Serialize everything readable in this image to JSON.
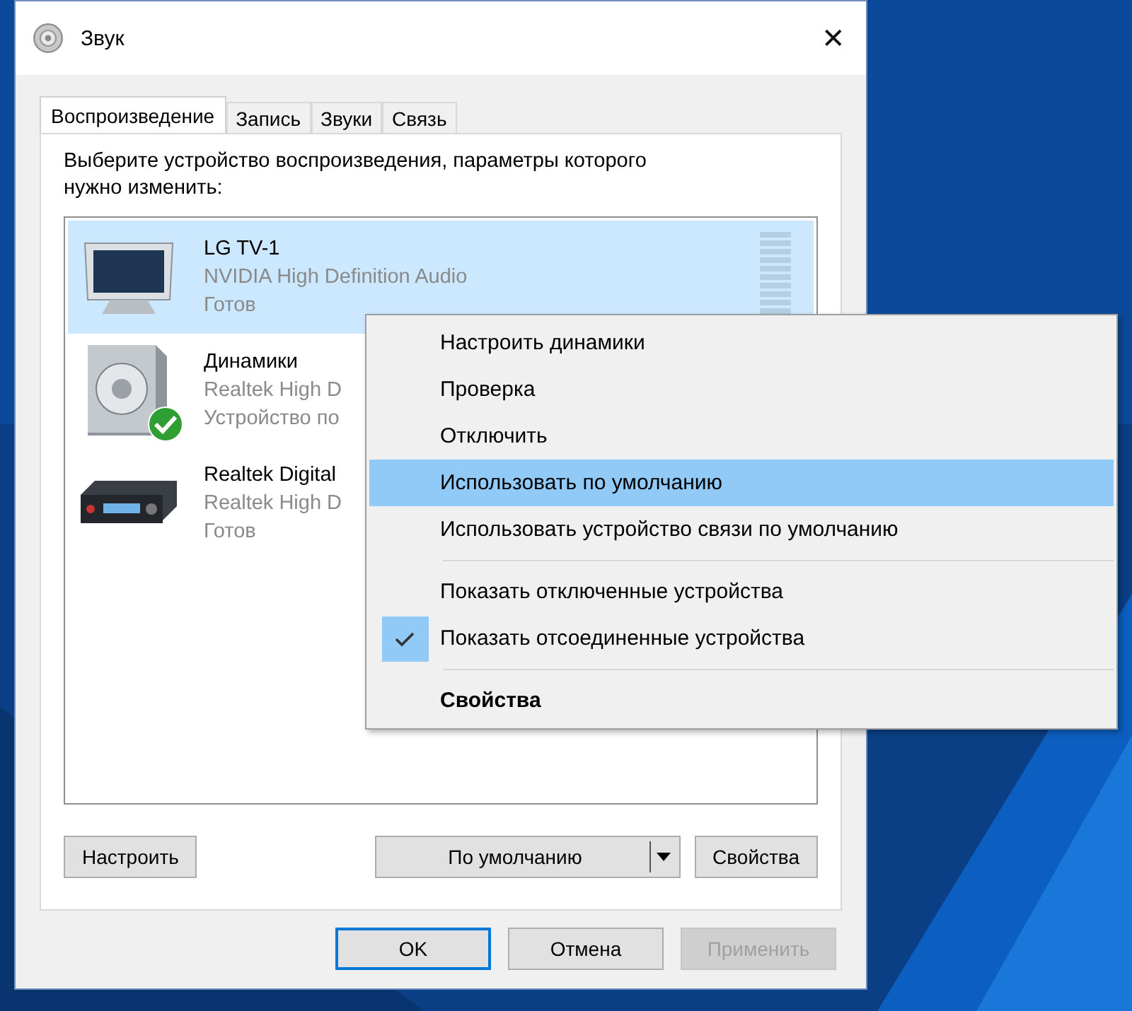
{
  "window": {
    "title": "Звук",
    "close": "✕"
  },
  "tabs": [
    {
      "label": "Воспроизведение",
      "selected": true
    },
    {
      "label": "Запись",
      "selected": false
    },
    {
      "label": "Звуки",
      "selected": false
    },
    {
      "label": "Связь",
      "selected": false
    }
  ],
  "instruction": "Выберите устройство воспроизведения, параметры которого нужно изменить:",
  "devices": [
    {
      "kind": "tv",
      "name": "LG TV-1",
      "driver": "NVIDIA High Definition Audio",
      "status": "Готов",
      "selected": true,
      "default": false,
      "level": 0
    },
    {
      "kind": "speaker",
      "name": "Динамики",
      "driver": "Realtek High D",
      "status": "Устройство по",
      "selected": false,
      "default": true
    },
    {
      "kind": "receiver",
      "name": "Realtek Digital",
      "driver": "Realtek High D",
      "status": "Готов",
      "selected": false,
      "default": false
    }
  ],
  "context_menu": [
    {
      "kind": "item",
      "label": "Настроить динамики",
      "selected": false,
      "checked": false,
      "bold": false
    },
    {
      "kind": "item",
      "label": "Проверка",
      "selected": false,
      "checked": false,
      "bold": false
    },
    {
      "kind": "item",
      "label": "Отключить",
      "selected": false,
      "checked": false,
      "bold": false
    },
    {
      "kind": "item",
      "label": "Использовать по умолчанию",
      "selected": true,
      "checked": false,
      "bold": false
    },
    {
      "kind": "item",
      "label": "Использовать устройство связи по умолчанию",
      "selected": false,
      "checked": false,
      "bold": false
    },
    {
      "kind": "separator"
    },
    {
      "kind": "item",
      "label": "Показать отключенные устройства",
      "selected": false,
      "checked": false,
      "bold": false
    },
    {
      "kind": "item",
      "label": "Показать отсоединенные устройства",
      "selected": false,
      "checked": true,
      "bold": false
    },
    {
      "kind": "separator"
    },
    {
      "kind": "item",
      "label": "Свойства",
      "selected": false,
      "checked": false,
      "bold": true
    }
  ],
  "panel_buttons": {
    "configure": "Настроить",
    "set_default": "По умолчанию",
    "properties": "Свойства"
  },
  "dialog_buttons": [
    {
      "label": "OK",
      "focused": true,
      "disabled": false
    },
    {
      "label": "Отмена",
      "focused": false,
      "disabled": false
    },
    {
      "label": "Применить",
      "focused": false,
      "disabled": true
    }
  ]
}
